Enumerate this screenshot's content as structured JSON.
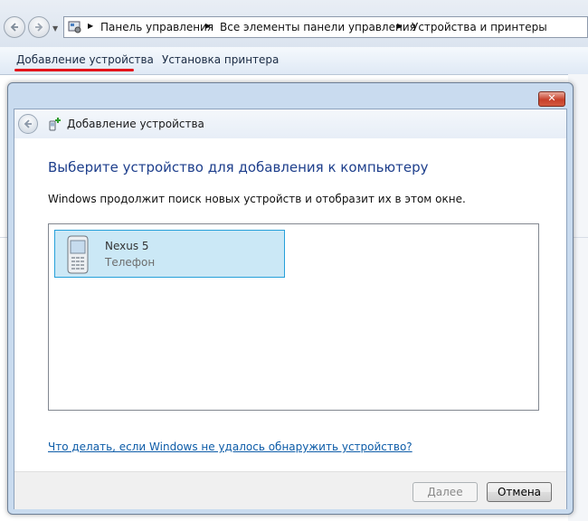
{
  "explorer": {
    "breadcrumbs": [
      "Панель управления",
      "Все элементы панели управления",
      "Устройства и принтеры"
    ],
    "icons": {
      "back": "back-arrow-icon",
      "forward": "forward-arrow-icon",
      "control_panel": "control-panel-icon"
    }
  },
  "command_bar": {
    "items": [
      "Добавление устройства",
      "Установка принтера"
    ],
    "highlight_color": "#e3141a"
  },
  "dialog": {
    "close_label": "✕",
    "title": "Добавление устройства",
    "heading": "Выберите устройство для добавления к компьютеру",
    "description": "Windows продолжит поиск новых устройств и отобразит их в этом окне.",
    "devices": [
      {
        "name": "Nexus 5",
        "type": "Телефон",
        "icon": "phone-icon",
        "selected": true
      }
    ],
    "help_link": "Что делать, если Windows не удалось обнаружить устройство?",
    "buttons": {
      "next": "Далее",
      "cancel": "Отмена"
    },
    "colors": {
      "heading": "#1e3f8c",
      "link": "#0d5ca8",
      "selection": "#cbe8f6"
    }
  }
}
